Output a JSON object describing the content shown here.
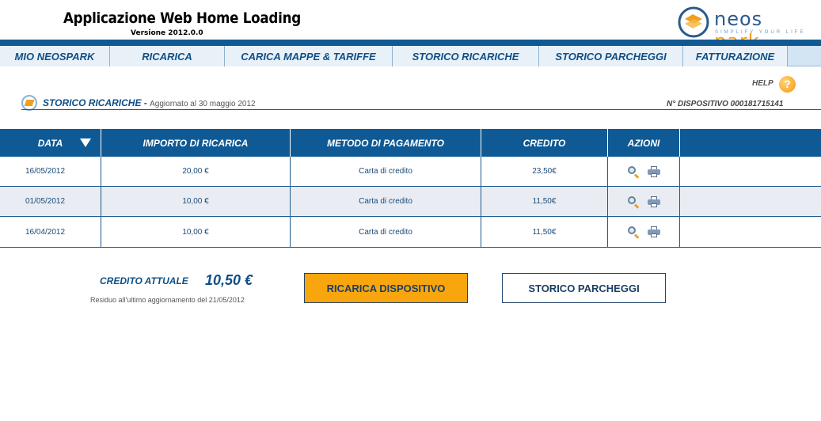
{
  "header": {
    "app_title": "Applicazione Web Home Loading",
    "version": "Versione 2012.0.0",
    "logo_text_1": "neos",
    "logo_text_2": "park",
    "logo_tagline": "SIMPLIFY YOUR LIFE"
  },
  "nav": [
    {
      "label": "MIO NEOSPARK"
    },
    {
      "label": "RICARICA"
    },
    {
      "label": "CARICA MAPPE & TARIFFE"
    },
    {
      "label": "STORICO RICARICHE"
    },
    {
      "label": "STORICO  PARCHEGGI"
    },
    {
      "label": "FATTURAZIONE"
    }
  ],
  "help": {
    "label": "HELP",
    "icon": "?"
  },
  "section": {
    "title": "STORICO RICARICHE -",
    "subtitle": "Aggiornato al 30 maggio 2012",
    "device": "N° DISPOSITIVO  000181715141"
  },
  "table": {
    "headers": [
      "DATA",
      "IMPORTO DI RICARICA",
      "METODO DI PAGAMENTO",
      "CREDITO",
      "AZIONI"
    ],
    "rows": [
      {
        "date": "16/05/2012",
        "amount": "20,00 €",
        "method": "Carta di credito",
        "credit": "23,50€"
      },
      {
        "date": "01/05/2012",
        "amount": "10,00 €",
        "method": "Carta di credito",
        "credit": "11,50€"
      },
      {
        "date": "16/04/2012",
        "amount": "10,00 €",
        "method": "Carta di credito",
        "credit": "11,50€"
      }
    ]
  },
  "credit": {
    "label": "CREDITO ATTUALE",
    "value": "10,50 €",
    "note": "Residuo all'ultimo aggiornamento del 21/05/2012"
  },
  "buttons": {
    "recharge": "RICARICA DISPOSITIVO",
    "history": "STORICO PARCHEGGI"
  },
  "colors": {
    "primary": "#0f5a94",
    "accent": "#f9a60e"
  }
}
